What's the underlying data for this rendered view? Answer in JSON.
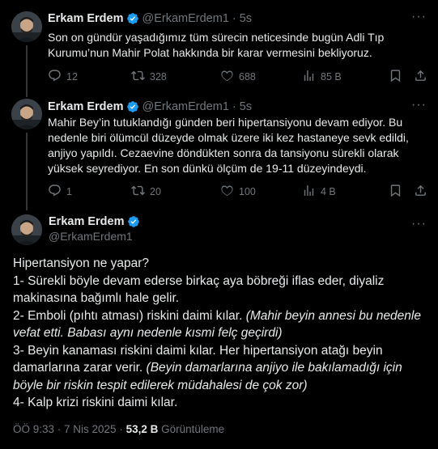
{
  "tweets": [
    {
      "name": "Erkam Erdem",
      "handle": "@ErkamErdem1",
      "time": "5s",
      "text": "Son on gündür yaşadığımız tüm sürecin neticesinde bugün Adli Tıp Kurumu’nun Mahir Polat hakkında bir karar vermesini bekliyoruz.",
      "replies": "12",
      "retweets": "328",
      "likes": "688",
      "views": "85 B"
    },
    {
      "name": "Erkam Erdem",
      "handle": "@ErkamErdem1",
      "time": "5s",
      "text": "Mahir Bey’in tutuklandığı günden beri hipertansiyonu devam ediyor. Bu nedenle biri ölümcül düzeyde olmak üzere iki kez hastaneye sevk edildi, anjiyo yapıldı. Cezaevine döndükten sonra da tansiyonu sürekli olarak yüksek seyrediyor. En son dünkü ölçüm de 19-11 düzeyindeydi.",
      "replies": "1",
      "retweets": "20",
      "likes": "100",
      "views": "4 B"
    }
  ],
  "main": {
    "name": "Erkam Erdem",
    "handle": "@ErkamErdem1",
    "intro": "Hipertansiyon ne yapar?",
    "p1": "1- Sürekli böyle devam ederse birkaç aya böbreği iflas eder, diyaliz makinasına bağımlı hale gelir.",
    "p2": "2- Emboli (pıhtı atması) riskini daimi kılar.",
    "p2_note": "(Mahir beyin annesi bu nedenle vefat etti. Babası aynı nedenle kısmi felç geçirdi)",
    "p3": "3- Beyin kanaması riskini daimi kılar. Her hipertansiyon atağı beyin damarlarına zarar verir.",
    "p3_note": "(Beyin damarlarına anjiyo ile bakılamadığı için böyle bir riskin tespit edilerek müdahalesi de çok zor)",
    "p4": "4- Kalp krizi riskini daimi kılar.",
    "timestamp": "ÖÖ 9:33 · 7 Nis 2025 ·",
    "views_count": "53,2 B",
    "views_label": "Görüntüleme"
  },
  "colors": {
    "background": "#000000",
    "text": "#e7e9ea",
    "muted": "#71767b",
    "verified": "#1d9bf0",
    "divider": "#2f3336"
  },
  "icons": [
    "verified-badge-icon",
    "more-icon",
    "reply-icon",
    "retweet-icon",
    "like-icon",
    "views-icon",
    "bookmark-icon",
    "share-icon"
  ]
}
